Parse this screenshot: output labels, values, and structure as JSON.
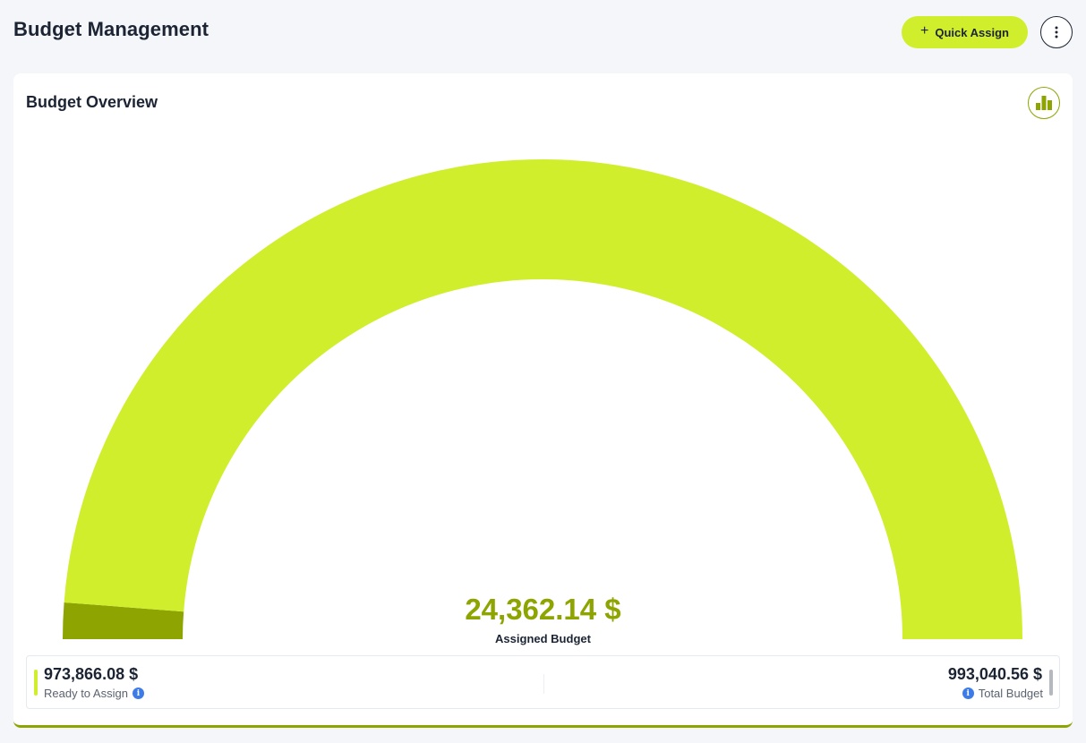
{
  "header": {
    "title": "Budget Management",
    "quick_assign_label": "Quick Assign",
    "quick_assign_icon": "plus-icon",
    "menu_icon": "kebab-menu-icon"
  },
  "overview": {
    "title": "Budget Overview",
    "chart_toggle_icon": "bar-chart-icon",
    "assigned_value": "24,362.14 $",
    "assigned_label": "Assigned Budget",
    "ready_value": "973,866.08 $",
    "ready_label": "Ready to Assign",
    "total_value": "993,040.56 $",
    "total_label": "Total Budget",
    "info_icon": "info-icon"
  },
  "chart_data": {
    "type": "gauge",
    "title": "",
    "segments": [
      {
        "label": "Assigned Budget",
        "value": 24362.14,
        "color": "#8ea400"
      },
      {
        "label": "Ready to Assign",
        "value": 973866.08,
        "color": "#d0ee2c"
      }
    ],
    "total": 993040.56
  },
  "colors": {
    "accent": "#d0ee2c",
    "accent_dark": "#8ea400",
    "info": "#3d7ce8",
    "background": "#f4f6f9"
  }
}
